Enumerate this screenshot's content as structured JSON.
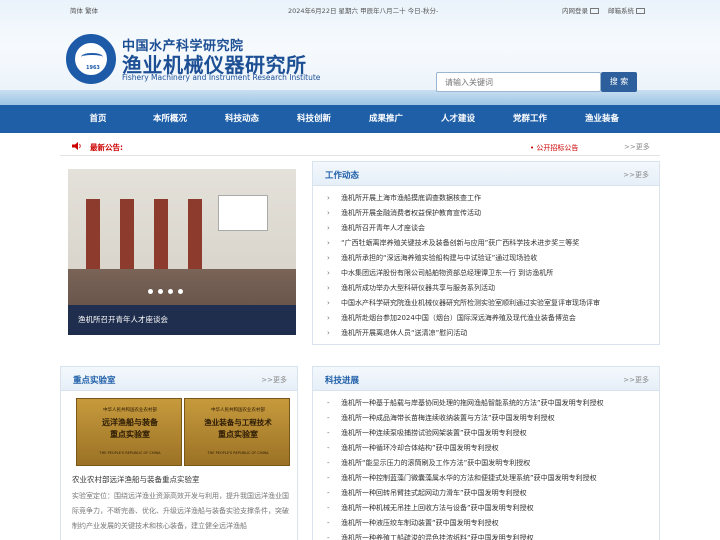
{
  "topbar": {
    "lang": "简体 繁体",
    "date": "2024年6月22日 星期六 甲辰年八月二十 今日-秋分-",
    "intranet": "内网登录",
    "mail": "邮箱系统"
  },
  "brand": {
    "name_cn_small": "中国水产科学研究院",
    "name_cn_large": "渔业机械仪器研究所",
    "name_en": "Fishery Machinery and Instrument Research Institute",
    "logo_year": "1963"
  },
  "search": {
    "placeholder": "请输入关键词",
    "button": "搜 索"
  },
  "nav": [
    "首页",
    "本所概况",
    "科技动态",
    "科技创新",
    "成果推广",
    "人才建设",
    "党群工作",
    "渔业装备"
  ],
  "notice": {
    "label": "最新公告:",
    "item": "• 公开招标公告",
    "more": ">>更多"
  },
  "slide": {
    "caption": "渔机所召开青年人才座谈会"
  },
  "work": {
    "title": "工作动态",
    "more": ">>更多",
    "items": [
      "渔机所开展上海市渔船摸底调查数据核查工作",
      "渔机所开展金融消费者权益保护教育宣传活动",
      "渔机所召开青年人才座谈会",
      "“广西牡蛎离岸养殖关键技术及装备创新与应用”获广西科学技术进步奖三等奖",
      "渔机所承担的“深远海养殖实验船构建与中试验证”通过现场验收",
      "中水集团远洋股份有限公司船舶物资部总经理谭卫东一行 到访渔机所",
      "渔机所成功举办大型科研仪器共享与服务系列活动",
      "中国水产科学研究院渔业机械仪器研究所检测实验室顺利通过实验室复评审现场评审",
      "渔机所赴烟台参加2024中国（烟台）国际深远海养殖及现代渔业装备博览会",
      "渔机所开展离退休人员“送清凉”慰问活动"
    ]
  },
  "lab": {
    "title": "重点实验室",
    "more": ">>更多",
    "plaque1": {
      "l1": "中华人民共和国农业农村部",
      "l2": "远洋渔船与装备",
      "l3": "重点实验室",
      "l4": "THE PEOPLE'S REPUBLIC OF CHINA"
    },
    "plaque2": {
      "l1": "中华人民共和国农业农村部",
      "l2": "渔业装备与工程技术",
      "l3": "重点实验室",
      "l4": "THE PEOPLE'S REPUBLIC OF CHINA"
    },
    "name": "农业农村部远洋渔船与装备重点实验室",
    "desc": "实验室定位：围绕远洋渔业资源高效开发与利用，提升我国远洋渔业国际竞争力，不断完善、优化、升级远洋渔船与装备实验支撑条件，突破制约产业发展的关键技术和核心装备，建立健全远洋渔船"
  },
  "progress": {
    "title": "科技进展",
    "more": ">>更多",
    "items": [
      "渔机所一种基于船载与岸基协同处理的拖网渔船智能系统的方法”获中国发明专利授权",
      "渔机所一种成品海带长苗梅连续收纳装置与方法”获中国发明专利授权",
      "渔机所一种连续泵吸捕捞试验网架装置”获中国发明专利授权",
      "渔机所一种循环冷却合体结构”获中国发明专利授权",
      "渔机所“能显示压力的滚筒刷及工作方法”获中国发明专利授权",
      "渔机所一种控制蓝藻门微囊藻属水华的方法和便捷式处理系统”获中国发明专利授权",
      "渔机所一种回转吊臂挂式起网动力滑车”获中国发明专利授权",
      "渔机所一种机械无吊挂上回收方法与设备”获中国发明专利授权",
      "渔机所一种液压绞车制动装置”获中国发明专利授权",
      "渔机所一种养殖工船疏浚的混色挂浓纸料”获中国发明专利授权"
    ]
  }
}
